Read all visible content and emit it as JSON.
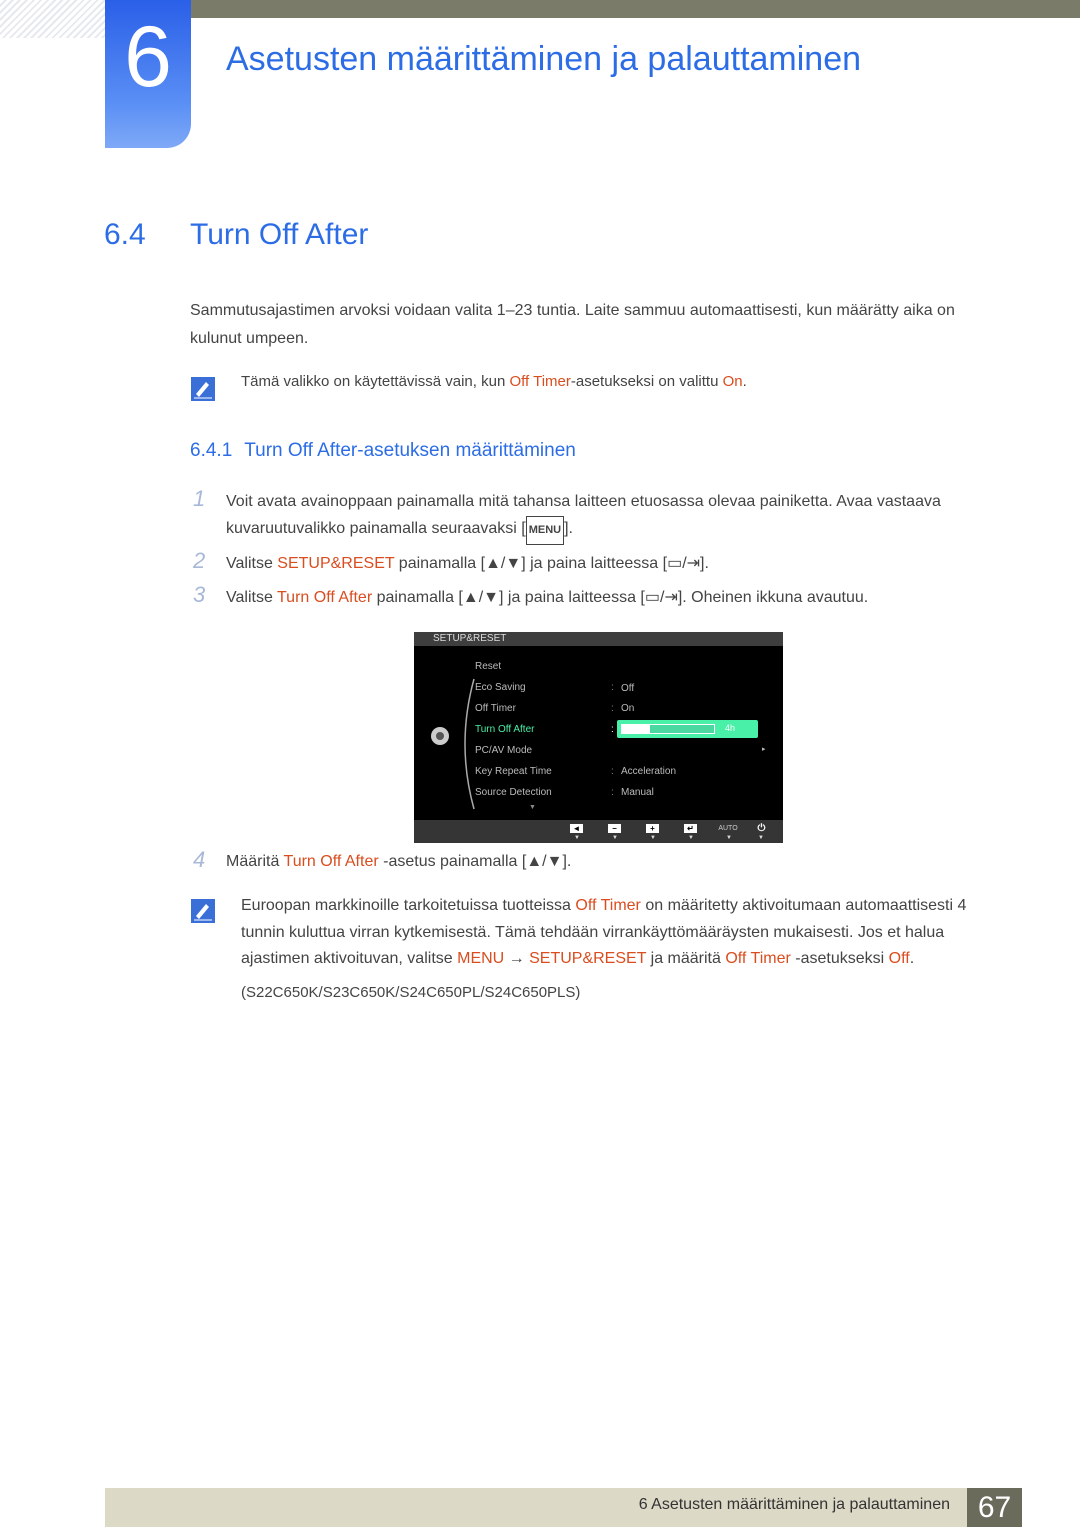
{
  "header": {
    "chapter_number": "6",
    "chapter_title": "Asetusten määrittäminen ja palauttaminen"
  },
  "section": {
    "number": "6.4",
    "title": "Turn Off After",
    "intro": "Sammutusajastimen arvoksi voidaan valita 1–23 tuntia. Laite sammuu automaattisesti, kun määrätty aika on kulunut umpeen.",
    "note1": {
      "icon": "note-pencil-icon",
      "prefix": "Tämä valikko on käytettävissä vain, kun ",
      "hl1": "Off Timer",
      "middle": "-asetukseksi on valittu ",
      "hl2": "On",
      "suffix": "."
    }
  },
  "subsection": {
    "number": "6.4.1",
    "title": "Turn Off After-asetuksen määrittäminen"
  },
  "steps": [
    {
      "num": "1",
      "text_a": "Voit avata avainoppaan painamalla mitä tahansa laitteen etuosassa olevaa painiketta. Avaa vastaava kuvaruutuvalikko painamalla seuraavaksi [",
      "key": "MENU",
      "text_b": "]."
    },
    {
      "num": "2",
      "text_a": "Valitse ",
      "hl": "SETUP&RESET",
      "text_b": " painamalla [",
      "text_c": "] ja paina laitteessa [",
      "text_d": "]."
    },
    {
      "num": "3",
      "text_a": "Valitse ",
      "hl": "Turn Off After",
      "text_b": " painamalla [",
      "text_c": "] ja paina laitteessa [",
      "text_d": "]. Oheinen ikkuna avautuu."
    },
    {
      "num": "4",
      "text_a": "Määritä ",
      "hl": "Turn Off After",
      "text_b": " -asetus painamalla [",
      "text_c": "]."
    }
  ],
  "osd": {
    "title": "SETUP&RESET",
    "items": [
      {
        "label": "Reset",
        "value": ""
      },
      {
        "label": "Eco Saving",
        "value": "Off"
      },
      {
        "label": "Off Timer",
        "value": "On"
      },
      {
        "label": "Turn Off After",
        "value": "4h",
        "selected": true,
        "progress_fraction": 0.3
      },
      {
        "label": "PC/AV Mode",
        "value": "▸"
      },
      {
        "label": "Key Repeat Time",
        "value": "Acceleration"
      },
      {
        "label": "Source Detection",
        "value": "Manual"
      }
    ],
    "buttons": [
      "◄",
      "−",
      "+",
      "↵",
      "AUTO",
      "⏻"
    ],
    "accent_color": "#49f0a7"
  },
  "note2": {
    "a": "Euroopan markkinoille tarkoitetuissa tuotteissa ",
    "hl1": "Off Timer",
    "b": " on määritetty aktivoitumaan automaattisesti 4 tunnin kuluttua virran kytkemisestä. Tämä tehdään virrankäyttömääräysten mukaisesti. Jos et halua ajastimen aktivoituvan, valitse ",
    "hl2": "MENU",
    "arrow": " → ",
    "hl3": "SETUP&RESET",
    "c": " ja määritä ",
    "hl4": "Off Timer",
    "d": " -asetukseksi ",
    "hl5": "Off",
    "e": ".",
    "models": "(S22C650K/S23C650K/S24C650PL/S24C650PLS)"
  },
  "footer": {
    "text": "6 Asetusten määrittäminen ja palauttaminen",
    "page": "67"
  }
}
